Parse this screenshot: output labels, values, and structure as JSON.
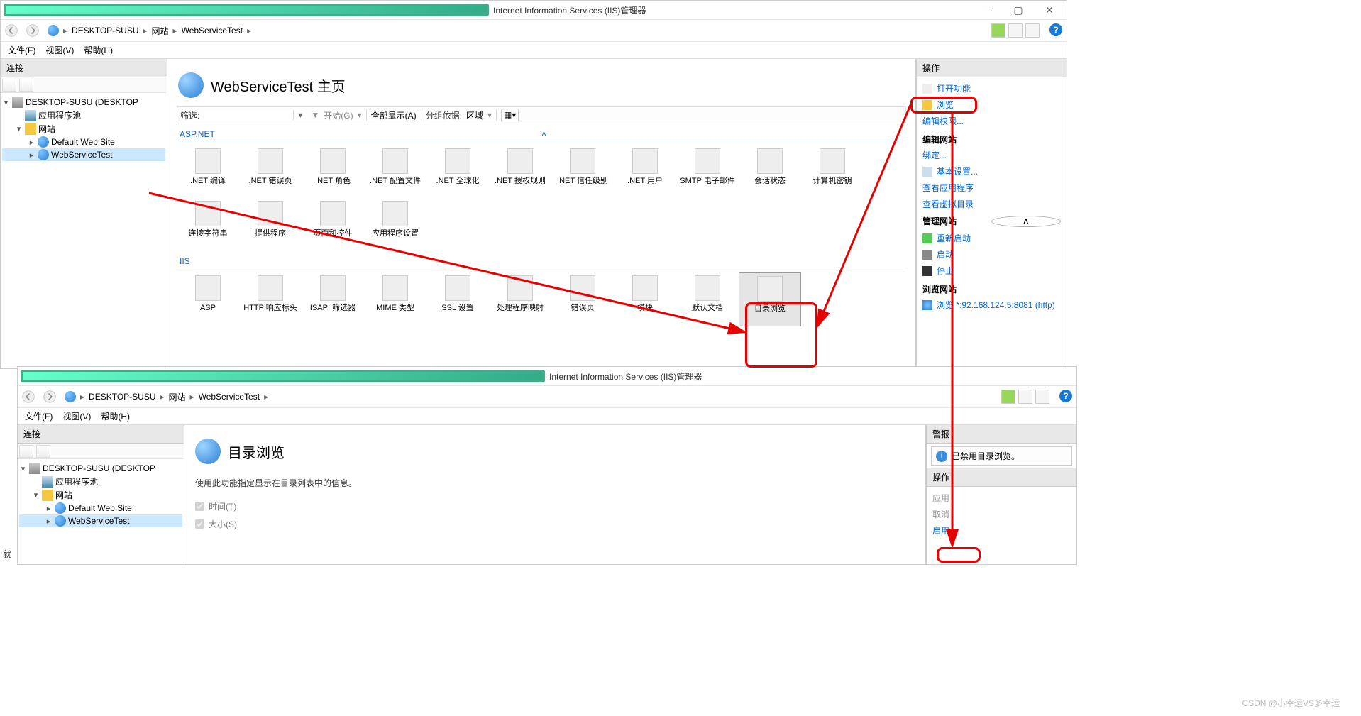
{
  "app": {
    "title": "Internet Information Services (IIS)管理器",
    "minimize": "—",
    "maximize": "▢",
    "close": "✕"
  },
  "nav": {
    "crumb_root": "DESKTOP-SUSU",
    "crumb_sites": "网站",
    "crumb_site": "WebServiceTest",
    "sep": "▸"
  },
  "menu": {
    "file": "文件(F)",
    "view": "视图(V)",
    "help": "帮助(H)"
  },
  "left": {
    "header": "连接",
    "server": "DESKTOP-SUSU (DESKTOP",
    "apppools": "应用程序池",
    "sites": "网站",
    "site_default": "Default Web Site",
    "site_ws": "WebServiceTest"
  },
  "center": {
    "title": "WebServiceTest 主页",
    "filter_label": "筛选:",
    "go": "开始(G)",
    "showall": "全部显示(A)",
    "groupby_label": "分组依据:",
    "groupby_value": "区域",
    "group_aspnet": "ASP.NET",
    "group_iis": "IIS",
    "aspnet_items": [
      ".NET 编译",
      ".NET 错误页",
      ".NET 角色",
      ".NET 配置文件",
      ".NET 全球化",
      ".NET 授权规则",
      ".NET 信任级别",
      ".NET 用户",
      "SMTP 电子邮件",
      "会话状态",
      "计算机密钥",
      "连接字符串",
      "提供程序",
      "页面和控件",
      "应用程序设置"
    ],
    "iis_items": [
      "ASP",
      "HTTP 响应标头",
      "ISAPI 筛选器",
      "MIME 类型",
      "SSL 设置",
      "处理程序映射",
      "错误页",
      "模块",
      "默认文档",
      "目录浏览"
    ]
  },
  "actions": {
    "header": "操作",
    "open_feature": "打开功能",
    "browse": "浏览",
    "edit_perm": "编辑权限...",
    "edit_site_hdr": "编辑网站",
    "bindings": "绑定...",
    "basic_settings": "基本设置...",
    "view_apps": "查看应用程序",
    "view_vdirs": "查看虚拟目录",
    "manage_site_hdr": "管理网站",
    "restart": "重新启动",
    "start": "启动",
    "stop": "停止",
    "browse_site_hdr": "浏览网站",
    "browse_link": "浏览 *:92.168.124.5:8081 (http)"
  },
  "page2": {
    "title": "目录浏览",
    "desc": "使用此功能指定显示在目录列表中的信息。",
    "chk_time": "时间(T)",
    "chk_size": "大小(S)",
    "alert_hdr": "警报",
    "alert_msg": "已禁用目录浏览。",
    "actions_hdr": "操作",
    "apply": "应用",
    "cancel": "取消",
    "enable": "启用"
  },
  "misc": {
    "truncated": "就",
    "watermark": "CSDN @小幸运VS多幸运"
  }
}
